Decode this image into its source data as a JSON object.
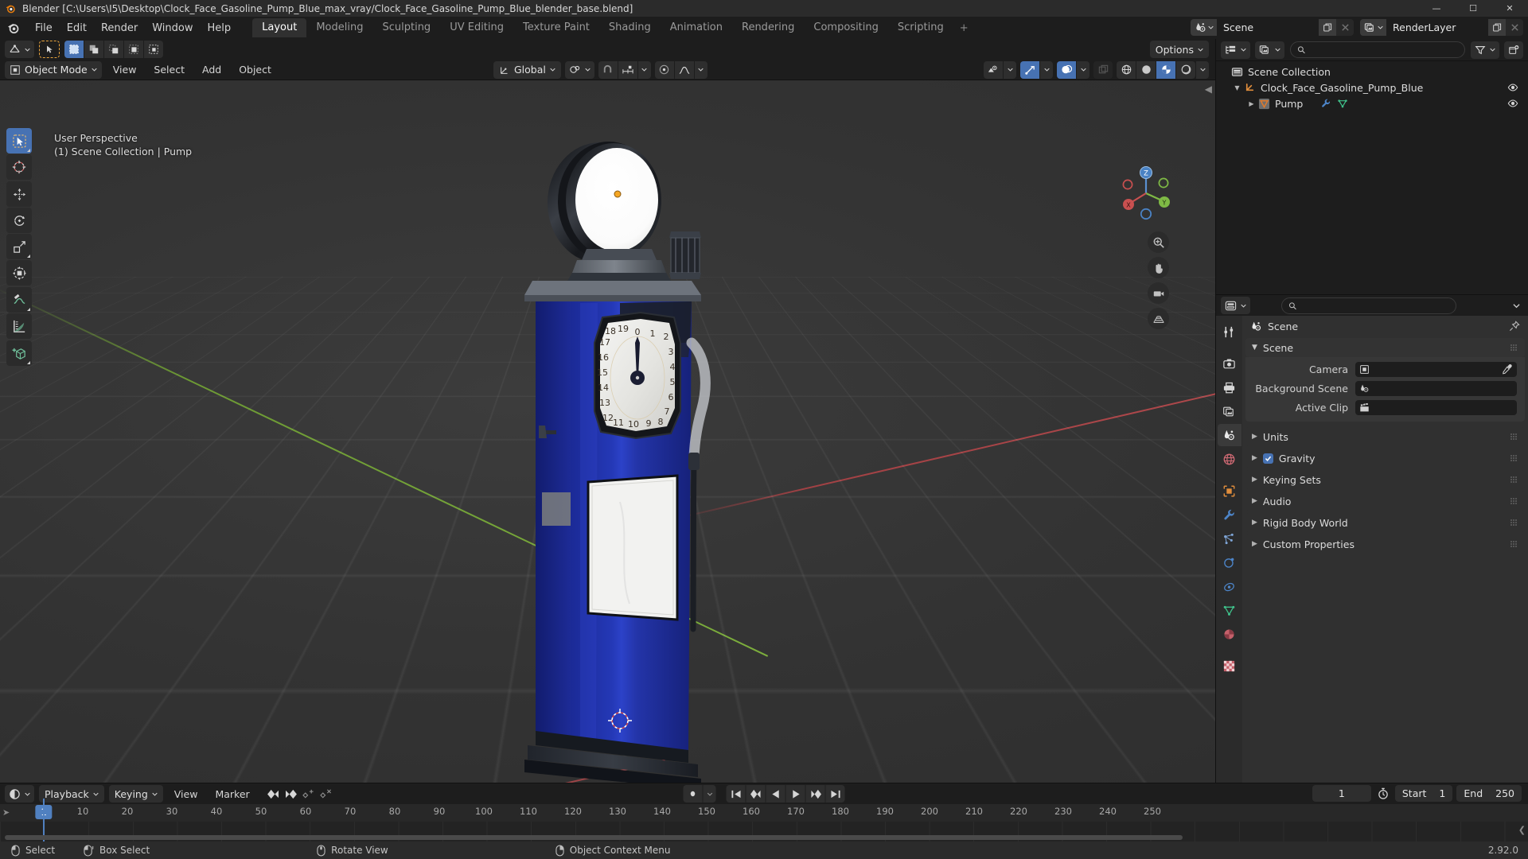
{
  "window": {
    "title": "Blender [C:\\Users\\I5\\Desktop\\Clock_Face_Gasoline_Pump_Blue_max_vray/Clock_Face_Gasoline_Pump_Blue_blender_base.blend]",
    "minimize": "—",
    "maximize": "☐",
    "close": "✕"
  },
  "topbar": {
    "menus": [
      "File",
      "Edit",
      "Render",
      "Window",
      "Help"
    ],
    "workspace_tabs": [
      {
        "label": "Layout",
        "active": true
      },
      {
        "label": "Modeling",
        "active": false
      },
      {
        "label": "Sculpting",
        "active": false
      },
      {
        "label": "UV Editing",
        "active": false
      },
      {
        "label": "Texture Paint",
        "active": false
      },
      {
        "label": "Shading",
        "active": false
      },
      {
        "label": "Animation",
        "active": false
      },
      {
        "label": "Rendering",
        "active": false
      },
      {
        "label": "Compositing",
        "active": false
      },
      {
        "label": "Scripting",
        "active": false
      }
    ],
    "add_workspace": "+",
    "scene_name": "Scene",
    "viewlayer_name": "RenderLayer"
  },
  "viewport": {
    "header": {
      "editor_type": "editor-type-3dview",
      "select_mode_tools": [
        "set-new",
        "extend",
        "subtract",
        "invert",
        "intersect"
      ],
      "mode": "Object Mode",
      "menus": [
        "View",
        "Select",
        "Add",
        "Object"
      ],
      "transform_orientation": "Global",
      "snap_enabled": false,
      "proportional_edit": false,
      "options_label": "Options"
    },
    "overlay_text_line1": "User Perspective",
    "overlay_text_line2": "(1) Scene Collection | Pump",
    "toolbar_tools": [
      "tweak-select-tool",
      "cursor-tool",
      "move-tool",
      "rotate-tool",
      "scale-tool",
      "transform-tool",
      "annotate-tool",
      "measure-tool",
      "add-cube-tool"
    ],
    "gizmo_axes": [
      "Z",
      "Y",
      "X"
    ],
    "shading_modes": [
      "wireframe",
      "solid",
      "material-preview",
      "rendered"
    ],
    "active_shading": "material-preview"
  },
  "outliner": {
    "display_mode": "View Layer",
    "search_placeholder": "",
    "rows": [
      {
        "label": "Scene Collection",
        "indent": 0,
        "icon": "collection-icon",
        "expander": "",
        "eye": false
      },
      {
        "label": "Clock_Face_Gasoline_Pump_Blue",
        "indent": 1,
        "icon": "empty-axis-icon",
        "expander": "▼",
        "eye": true
      },
      {
        "label": "Pump",
        "indent": 2,
        "icon": "mesh-data-icon",
        "expander": "▶",
        "eye": true
      }
    ]
  },
  "properties": {
    "breadcrumb": "Scene",
    "search_placeholder": "",
    "tabs": [
      "tool-icon",
      "render-icon",
      "output-icon",
      "view-layer-icon",
      "scene-icon",
      "world-icon",
      "object-icon",
      "modifier-icon",
      "particles-icon",
      "physics-icon",
      "constraints-icon",
      "data-icon",
      "material-icon",
      "texture-icon"
    ],
    "active_tab": "scene-icon",
    "panels": [
      {
        "label": "Scene",
        "open": true,
        "checkbox": null
      },
      {
        "label": "Units",
        "open": false,
        "checkbox": null
      },
      {
        "label": "Gravity",
        "open": false,
        "checkbox": true
      },
      {
        "label": "Keying Sets",
        "open": false,
        "checkbox": null
      },
      {
        "label": "Audio",
        "open": false,
        "checkbox": null
      },
      {
        "label": "Rigid Body World",
        "open": false,
        "checkbox": null
      },
      {
        "label": "Custom Properties",
        "open": false,
        "checkbox": null
      }
    ],
    "scene_fields": [
      {
        "label": "Camera",
        "value": "",
        "icon": "camera-icon",
        "eyedropper": true
      },
      {
        "label": "Background Scene",
        "value": "",
        "icon": "scene-icon",
        "eyedropper": false
      },
      {
        "label": "Active Clip",
        "value": "",
        "icon": "clip-icon",
        "eyedropper": false
      }
    ]
  },
  "timeline": {
    "editor_type": "editor-type-timeline",
    "menus": [
      "Playback",
      "Keying",
      "View",
      "Marker"
    ],
    "keyframe_buttons": [
      "jump-prev-keyframe",
      "jump-next-keyframe",
      "insert-keyframe",
      "delete-keyframe"
    ],
    "playback_buttons": [
      "jump-start",
      "prev-keyframe",
      "play-reverse",
      "play",
      "next-keyframe",
      "jump-end"
    ],
    "current_frame": "1",
    "start_label": "Start",
    "start_value": "1",
    "end_label": "End",
    "end_value": "250",
    "ruler_ticks": [
      "1",
      "10",
      "20",
      "30",
      "40",
      "50",
      "60",
      "70",
      "80",
      "90",
      "100",
      "110",
      "120",
      "130",
      "140",
      "150",
      "160",
      "170",
      "180",
      "190",
      "200",
      "210",
      "220",
      "230",
      "240",
      "250"
    ],
    "playhead_frame": "1"
  },
  "statusbar": {
    "items": [
      {
        "icon": "mouse-left-icon",
        "label": "Select"
      },
      {
        "icon": "mouse-left-drag-icon",
        "label": "Box Select"
      },
      {
        "icon": "mouse-middle-icon",
        "label": "Rotate View"
      },
      {
        "icon": "mouse-right-icon",
        "label": "Object Context Menu"
      }
    ],
    "version": "2.92.0"
  },
  "model": {
    "name": "Clock_Face_Gasoline_Pump_Blue",
    "body_color": "#2333ad",
    "clock_numbers": [
      "0",
      "1",
      "2",
      "3",
      "4",
      "5",
      "6",
      "7",
      "8",
      "9",
      "10",
      "11",
      "12",
      "13",
      "14",
      "15",
      "16",
      "17",
      "18",
      "19"
    ],
    "origin_marker_color": "#f5a623"
  },
  "colors": {
    "accent_blue": "#4772b3",
    "panel_bg": "#303030",
    "header_bg": "#1d1d1d",
    "axis_x": "#a24144",
    "axis_y": "#6d9a34"
  }
}
